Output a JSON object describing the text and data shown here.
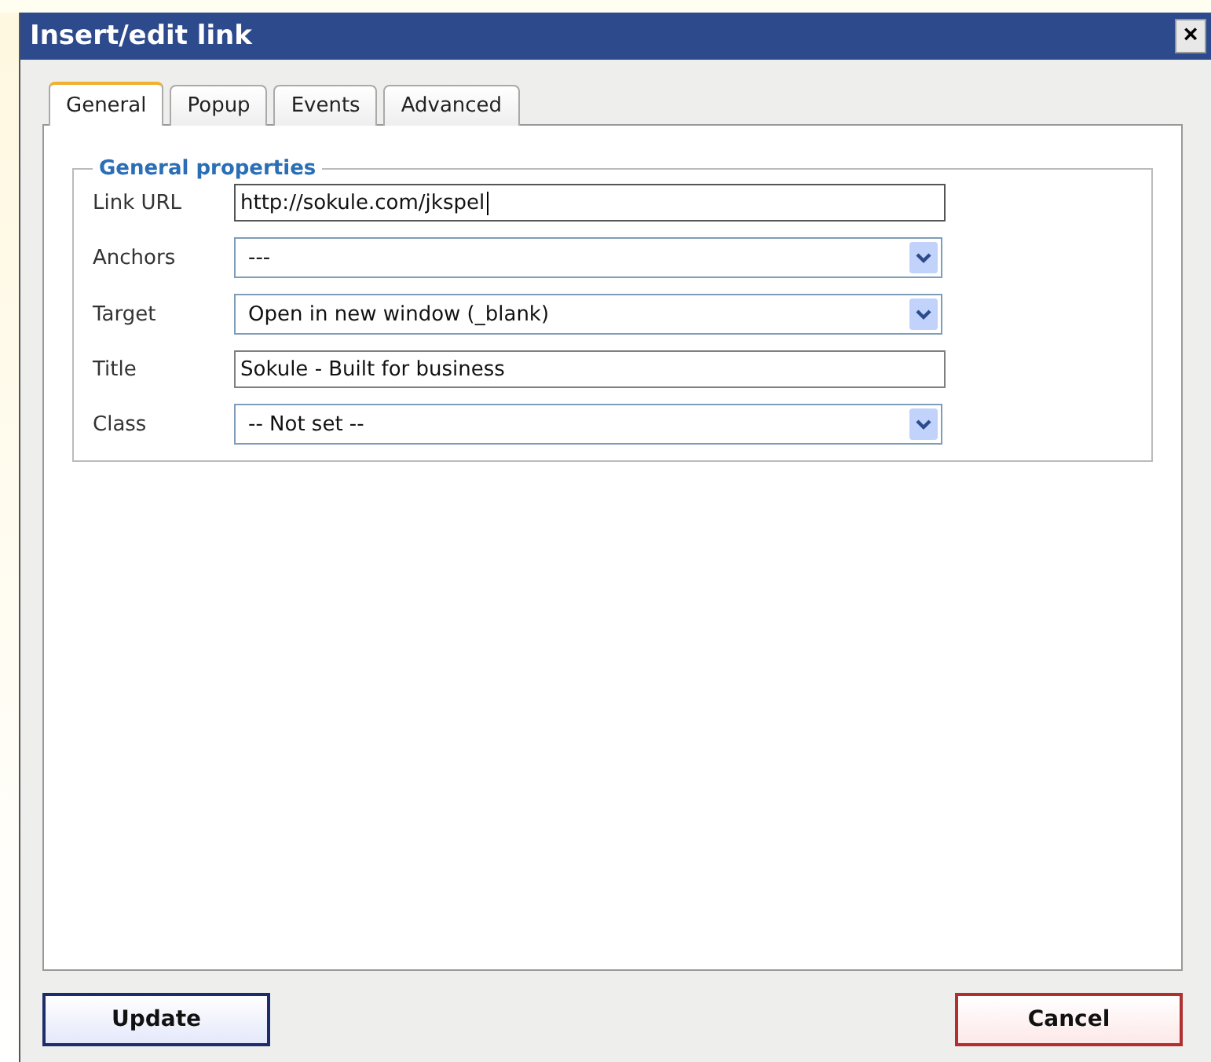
{
  "window": {
    "title": "Insert/edit link",
    "close": "×"
  },
  "tabs": [
    {
      "label": "General",
      "selected": true
    },
    {
      "label": "Popup",
      "selected": false
    },
    {
      "label": "Events",
      "selected": false
    },
    {
      "label": "Advanced",
      "selected": false
    }
  ],
  "group": {
    "legend": "General properties",
    "fields": [
      {
        "kind": "text",
        "label": "Link URL",
        "value": "http://sokule.com/jkspel",
        "focused": true
      },
      {
        "kind": "select",
        "label": "Anchors",
        "value": "---"
      },
      {
        "kind": "select",
        "label": "Target",
        "value": "Open in new window (_blank)"
      },
      {
        "kind": "text",
        "label": "Title",
        "value": "Sokule - Built for business",
        "focused": false
      },
      {
        "kind": "select",
        "label": "Class",
        "value": "-- Not set --"
      }
    ]
  },
  "buttons": [
    {
      "kind": "primary",
      "label": "Update"
    },
    {
      "kind": "cancel",
      "label": "Cancel"
    }
  ]
}
